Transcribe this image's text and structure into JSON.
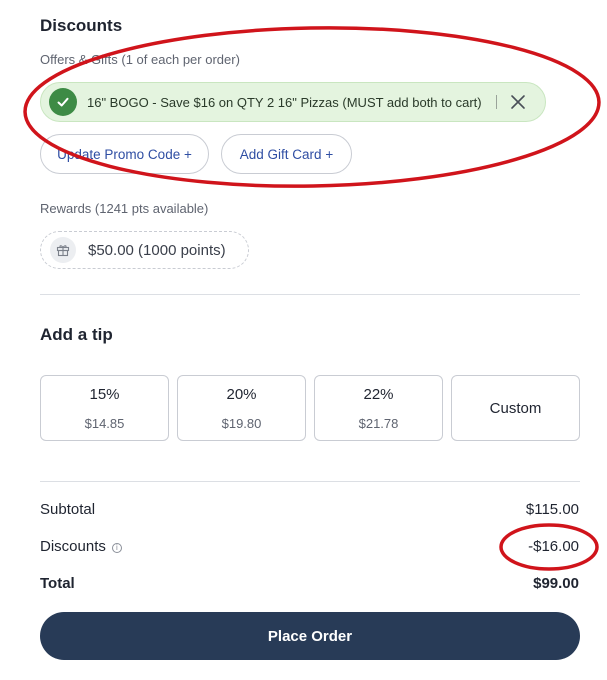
{
  "discounts": {
    "title": "Discounts",
    "offers_label": "Offers & Gifts (1 of each per order)",
    "applied_offer": "16\" BOGO - Save $16 on QTY 2 16\" Pizzas (MUST add both to cart)",
    "update_promo_label": "Update Promo Code +",
    "add_gift_card_label": "Add Gift Card +"
  },
  "rewards": {
    "label": "Rewards (1241 pts available)",
    "option": "$50.00 (1000 points)"
  },
  "tip": {
    "title": "Add a tip",
    "options": [
      {
        "percent": "15%",
        "amount": "$14.85"
      },
      {
        "percent": "20%",
        "amount": "$19.80"
      },
      {
        "percent": "22%",
        "amount": "$21.78"
      }
    ],
    "custom_label": "Custom"
  },
  "summary": {
    "subtotal_label": "Subtotal",
    "subtotal_value": "$115.00",
    "discounts_label": "Discounts",
    "discounts_value": "-$16.00",
    "total_label": "Total",
    "total_value": "$99.00"
  },
  "place_order_label": "Place Order",
  "colors": {
    "accent_navy": "#283b57",
    "success_green": "#3d8b45",
    "link_blue": "#2f4ea3",
    "annotation_red": "#d0141b"
  },
  "icons": [
    "check-icon",
    "close-icon",
    "gift-icon",
    "info-icon"
  ]
}
